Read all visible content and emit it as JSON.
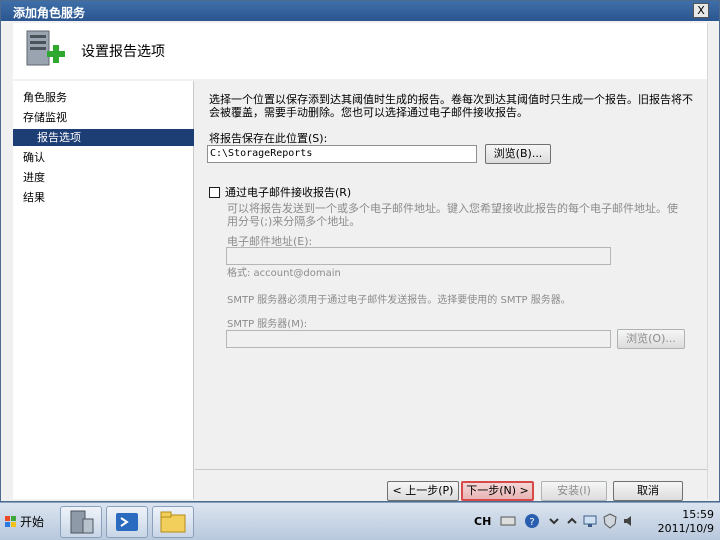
{
  "window": {
    "title": "添加角色服务",
    "close_label": "X"
  },
  "header": {
    "title": "设置报告选项"
  },
  "sidebar": {
    "items": [
      {
        "label": "角色服务",
        "active": false
      },
      {
        "label": "存储监视",
        "active": false
      },
      {
        "label": "报告选项",
        "active": true
      },
      {
        "label": "确认",
        "active": false
      },
      {
        "label": "进度",
        "active": false
      },
      {
        "label": "结果",
        "active": false
      }
    ]
  },
  "content": {
    "description": "选择一个位置以保存添到达其阈值时生成的报告。卷每次到达其阈值时只生成一个报告。旧报告将不会被覆盖，需要手动删除。您也可以选择通过电子邮件接收报告。",
    "save_location_label": "将报告保存在此位置(S):",
    "save_location_value": "C:\\StorageReports",
    "browse_label": "浏览(B)...",
    "email_checkbox_label": "通过电子邮件接收报告(R)",
    "email_description": "可以将报告发送到一个或多个电子邮件地址。键入您希望接收此报告的每个电子邮件地址。使用分号(;)来分隔多个地址。",
    "email_address_label": "电子邮件地址(E):",
    "email_address_value": "",
    "format_hint": "格式: account@domain",
    "smtp_description": "SMTP 服务器必须用于通过电子邮件发送报告。选择要使用的 SMTP 服务器。",
    "smtp_label": "SMTP 服务器(M):",
    "smtp_value": "",
    "smtp_browse_label": "浏览(O)..."
  },
  "footer": {
    "prev_label": "< 上一步(P)",
    "next_label": "下一步(N) >",
    "install_label": "安装(I)",
    "cancel_label": "取消"
  },
  "taskbar": {
    "start_label": "开始",
    "lang_label": "CH",
    "time": "15:59",
    "date": "2011/10/9"
  },
  "colors": {
    "title_bar": "#2b5590",
    "sidebar_active": "#1d3d75",
    "primary_border": "#d64a4a"
  }
}
